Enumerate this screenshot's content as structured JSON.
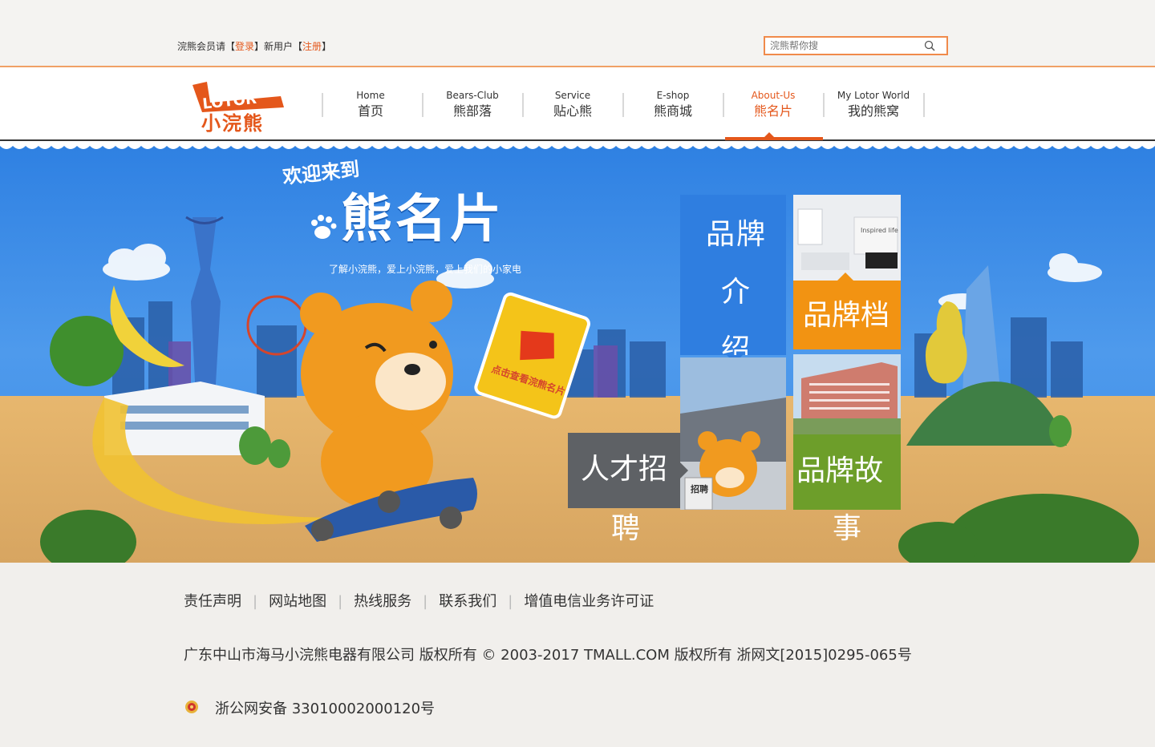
{
  "header": {
    "member_prefix": "浣熊会员请【",
    "login_label": "登录",
    "member_mid": "】新用户【",
    "register_label": "注册",
    "member_suffix": "】",
    "search_placeholder": "浣熊帮你搜"
  },
  "logo": {
    "text_en": "LOTOR",
    "text_cn": "小浣熊"
  },
  "nav": {
    "items": [
      {
        "en": "Home",
        "cn": "首页"
      },
      {
        "en": "Bears-Club",
        "cn": "熊部落"
      },
      {
        "en": "Service",
        "cn": "贴心熊"
      },
      {
        "en": "E-shop",
        "cn": "熊商城"
      },
      {
        "en": "About-Us",
        "cn": "熊名片",
        "active": true
      },
      {
        "en": "My Lotor World",
        "cn": "我的熊窝"
      }
    ]
  },
  "hero": {
    "welcome": "欢迎来到",
    "title": "熊名片",
    "tagline": "了解小浣熊，爱上小浣熊，爱上我们的小家电",
    "card_text": "点击查看浣熊名片",
    "photo_text": "Inspired life"
  },
  "tiles": {
    "brand_intro_line1": "品牌介",
    "brand_intro_line2": "绍",
    "brand_archive": "品牌档",
    "brand_story_line1": "品牌故",
    "brand_story_line2": "事",
    "recruit_line1": "人才招",
    "recruit_line2": "聘",
    "recruit_sign": "招聘"
  },
  "footer": {
    "links": [
      "责任声明",
      "网站地图",
      "热线服务",
      "联系我们",
      "增值电信业务许可证"
    ],
    "copyright": "广东中山市海马小浣熊电器有限公司 版权所有  © 2003-2017 TMALL.COM 版权所有  浙网文[2015]0295-065号",
    "beian": "浙公网安备 33010002000120号"
  },
  "colors": {
    "accent": "#e4571b",
    "sky": "#3b8ae6",
    "tile_blue": "#2f7ee0",
    "tile_orange": "#f29312",
    "tile_green": "#6d9e2a",
    "tile_gray": "#5e6165"
  }
}
